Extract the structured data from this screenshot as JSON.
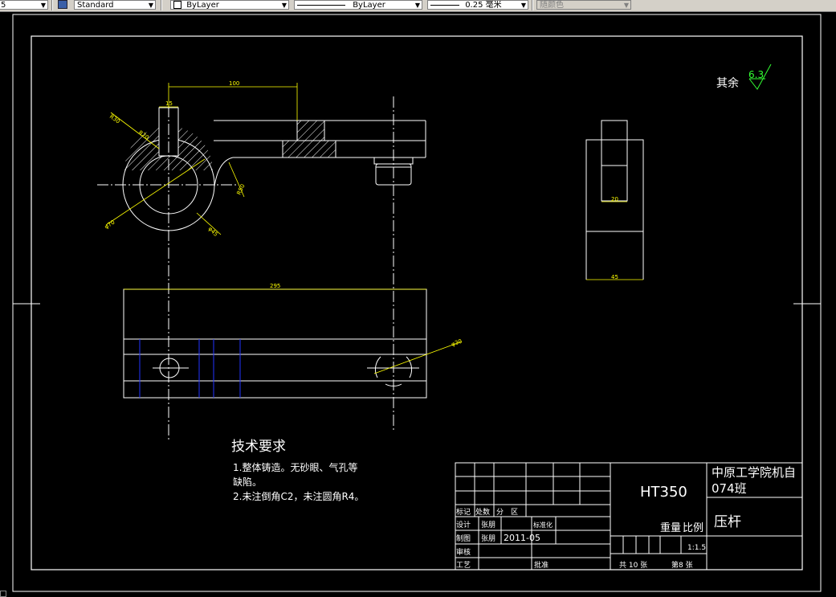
{
  "toolbar": {
    "style_name": "Standard",
    "layer": "ByLayer",
    "linetype": "ByLayer",
    "lineweight": "0.25 毫米",
    "color": "随颜色",
    "partial_left": "5"
  },
  "drawing": {
    "roughness_label": "其余",
    "roughness_value": "6.3",
    "dims": {
      "d100": "100",
      "d15": "15",
      "r30": "R30",
      "r20": "R20",
      "d70": "φ70",
      "d45": "φ45",
      "r50": "R50",
      "d20": "20",
      "d45b": "45",
      "d295": "295",
      "d30": "φ30"
    },
    "tech_title": "技术要求",
    "tech_line1": "1.整体铸造。无砂眼、气孔等",
    "tech_line2": "缺陷。",
    "tech_line3": "2.未注倒角C2，未注圆角R4。"
  },
  "title_block": {
    "material": "HT350",
    "school": "中原工学院机自",
    "class": "074班",
    "part_name": "压杆",
    "weight_label": "重量",
    "scale_label": "比例",
    "scale_value": "1:1.5",
    "total_sheets": "共 10 张",
    "sheet_no": "第8 张",
    "row_mark": "标记",
    "row_count": "处数",
    "row_zone": "分　区",
    "design": "设计",
    "design_name": "张朋",
    "standardize": "标准化",
    "draw": "制图",
    "draw_name": "张朋",
    "draw_date": "2011-05",
    "review": "审核",
    "process": "工艺",
    "approve": "批准"
  },
  "colors": {
    "background": "#000000",
    "lines": "#ffffff",
    "dims": "#ffff00",
    "center": "#ffffff",
    "blue": "#2233ff",
    "green": "#33ff33"
  }
}
